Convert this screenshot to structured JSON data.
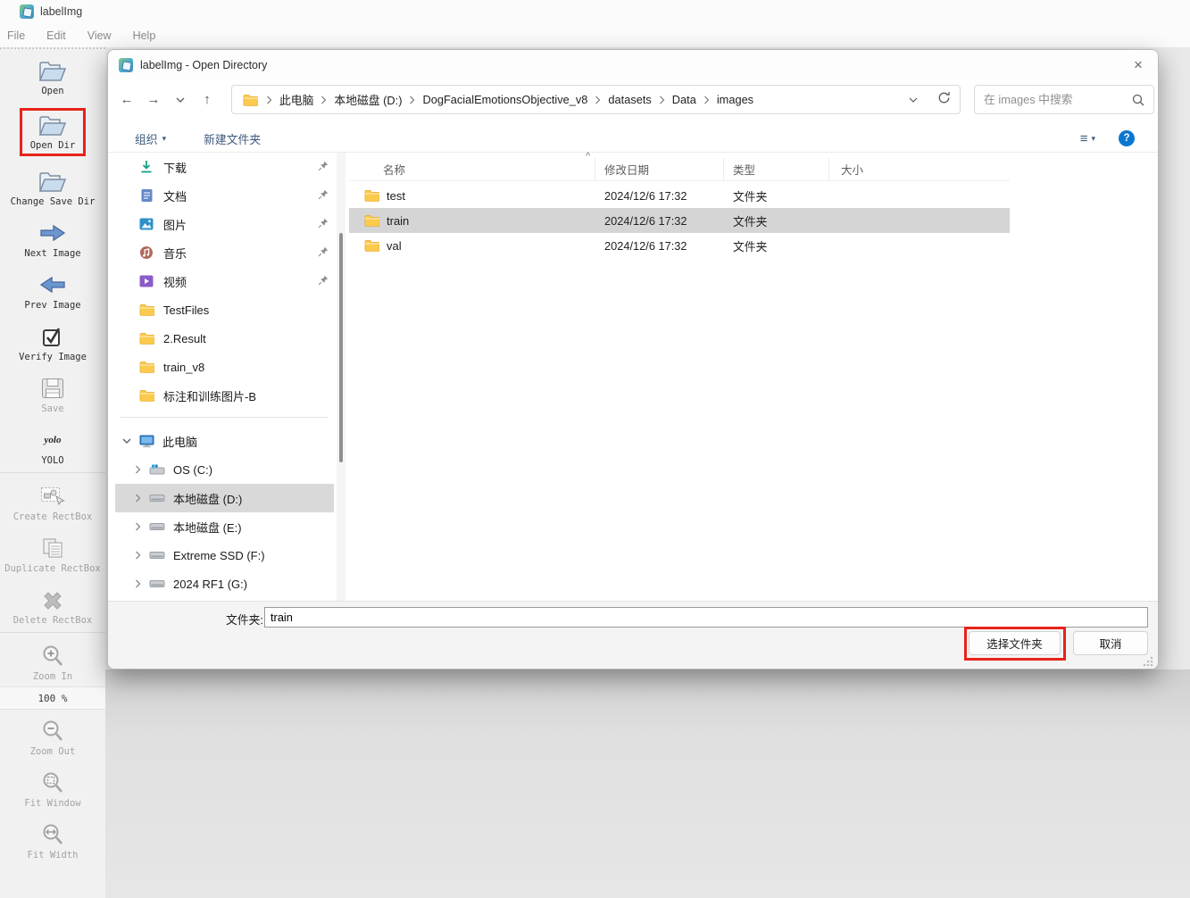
{
  "colors": {
    "highlight_red": "#e8231a",
    "help_blue": "#0b76d1",
    "selection_gray": "#d5d5d5",
    "folder_yellow": "#fccb5a",
    "command_blue": "#3f5b7c"
  },
  "glyphs": {
    "back": "←",
    "forward": "→",
    "up": "↑",
    "close": "×",
    "sort_asc": "^",
    "view_list": "≡",
    "dropdown": "▾",
    "help": "?"
  },
  "app": {
    "title": "labelImg",
    "menu": [
      "File",
      "Edit",
      "View",
      "Help"
    ]
  },
  "sidebar": {
    "items": [
      {
        "label": "Open"
      },
      {
        "label": "Open Dir"
      },
      {
        "label": "Change Save Dir"
      },
      {
        "label": "Next Image"
      },
      {
        "label": "Prev Image"
      },
      {
        "label": "Verify Image"
      },
      {
        "label": "Save"
      },
      {
        "label": "YOLO"
      },
      {
        "label": "Create RectBox"
      },
      {
        "label": "Duplicate RectBox"
      },
      {
        "label": "Delete RectBox"
      },
      {
        "label": "Zoom In"
      },
      {
        "label": "100 %"
      },
      {
        "label": "Zoom Out"
      },
      {
        "label": "Fit Window"
      },
      {
        "label": "Fit Width"
      }
    ]
  },
  "dialog": {
    "title": "labelImg - Open Directory",
    "breadcrumb": {
      "segments": [
        "此电脑",
        "本地磁盘 (D:)",
        "DogFacialEmotionsObjective_v8",
        "datasets",
        "Data",
        "images"
      ]
    },
    "search": {
      "placeholder": "在 images 中搜索"
    },
    "toolbar": {
      "organize": "组织",
      "new_folder": "新建文件夹"
    },
    "nav": {
      "quick": [
        {
          "label": "下载"
        },
        {
          "label": "文档"
        },
        {
          "label": "图片"
        },
        {
          "label": "音乐"
        },
        {
          "label": "视频"
        },
        {
          "label": "TestFiles"
        },
        {
          "label": "2.Result"
        },
        {
          "label": "train_v8"
        },
        {
          "label": "标注和训练图片-B"
        }
      ],
      "tree": [
        {
          "label": "此电脑"
        },
        {
          "label": "OS (C:)"
        },
        {
          "label": "本地磁盘 (D:)"
        },
        {
          "label": "本地磁盘 (E:)"
        },
        {
          "label": "Extreme SSD (F:)"
        },
        {
          "label": "2024 RF1 (G:)"
        }
      ]
    },
    "list": {
      "columns": [
        "名称",
        "修改日期",
        "类型",
        "大小"
      ],
      "rows": [
        {
          "name": "test",
          "date": "2024/12/6 17:32",
          "type": "文件夹"
        },
        {
          "name": "train",
          "date": "2024/12/6 17:32",
          "type": "文件夹"
        },
        {
          "name": "val",
          "date": "2024/12/6 17:32",
          "type": "文件夹"
        }
      ]
    },
    "footer": {
      "label": "文件夹:",
      "value": "train",
      "select": "选择文件夹",
      "cancel": "取消"
    }
  }
}
